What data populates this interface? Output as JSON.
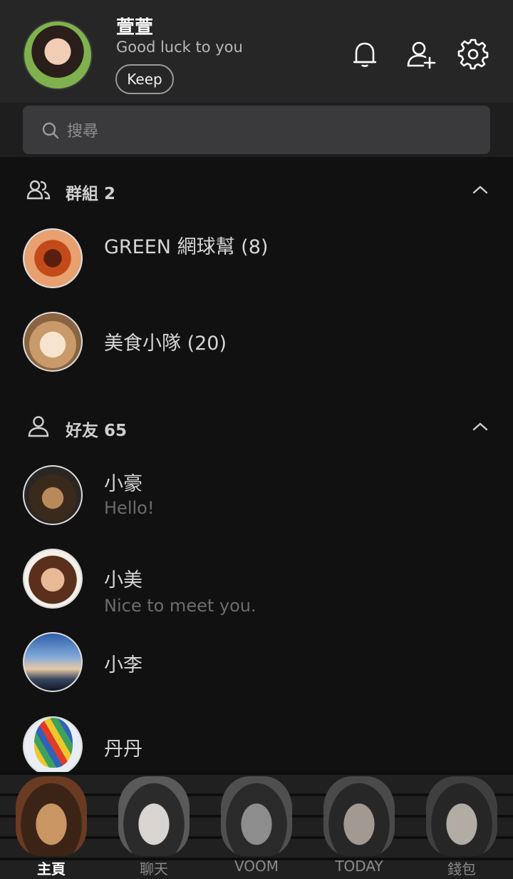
{
  "profile": {
    "name": "萱萱",
    "status": "Good luck to you",
    "keep_label": "Keep"
  },
  "header_icons": [
    "bell-icon",
    "add-friend-icon",
    "settings-icon"
  ],
  "search": {
    "placeholder": "搜尋"
  },
  "groups": {
    "title": "群組 2",
    "items": [
      {
        "name": "GREEN 網球幫 (8)"
      },
      {
        "name": "美食小隊 (20)"
      }
    ]
  },
  "friends": {
    "title": "好友 65",
    "items": [
      {
        "name": "小豪",
        "status": "Hello!"
      },
      {
        "name": "小美",
        "status": "Nice to meet you."
      },
      {
        "name": "小李",
        "status": ""
      },
      {
        "name": "丹丹",
        "status": ""
      }
    ]
  },
  "tabs": [
    {
      "label": "主頁",
      "active": true
    },
    {
      "label": "聊天",
      "active": false
    },
    {
      "label": "VOOM",
      "active": false
    },
    {
      "label": "TODAY",
      "active": false
    },
    {
      "label": "錢包",
      "active": false
    }
  ],
  "colors": {
    "background": "#111112",
    "header": "#262627",
    "search_box": "#3a3a3c",
    "text_primary": "#d6d6d6",
    "text_secondary": "#6c6c6e"
  }
}
